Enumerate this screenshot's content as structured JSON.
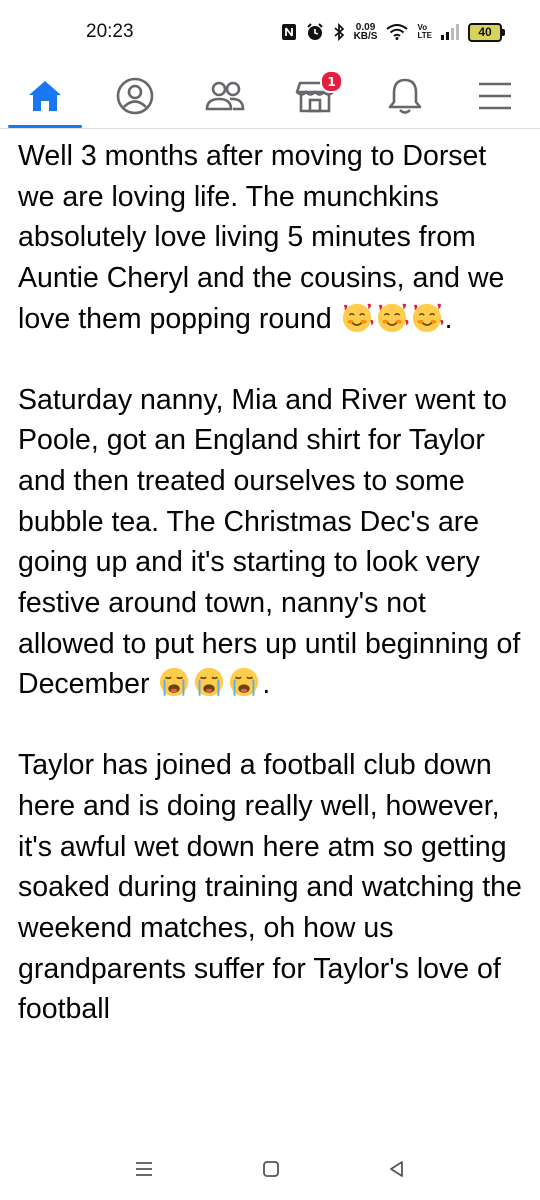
{
  "status_bar": {
    "time": "20:23",
    "net_speed_value": "0.09",
    "net_speed_unit": "KB/S",
    "volte_top": "Vo",
    "volte_bottom": "LTE",
    "battery": "40"
  },
  "nav": {
    "items": [
      {
        "name": "home",
        "icon": "home-icon",
        "active": true
      },
      {
        "name": "profile",
        "icon": "profile-icon"
      },
      {
        "name": "friends",
        "icon": "friends-icon"
      },
      {
        "name": "marketplace",
        "icon": "marketplace-icon",
        "badge": "1"
      },
      {
        "name": "notifications",
        "icon": "bell-icon"
      },
      {
        "name": "menu",
        "icon": "hamburger-icon"
      }
    ],
    "accent": "#1877f2",
    "badge_color": "#e41e3f"
  },
  "post": {
    "paragraph1": "Well 3 months after moving to Dorset we are loving life. The munchkins absolutely love living 5 minutes from Auntie Cheryl and the cousins, and we love them popping round",
    "paragraph1_end": ".",
    "paragraph2": "Saturday nanny,  Mia and River went to Poole,  got an England shirt for Taylor and then treated ourselves to some bubble tea. The Christmas Dec's are going up and it's starting to look very festive around town, nanny's not allowed to put hers up until beginning of December",
    "paragraph2_end": ".",
    "paragraph3": "Taylor has joined a football club down here and is doing really well, however, it's awful wet down here atm so getting soaked during training and watching the weekend matches, oh how us grandparents suffer for Taylor's love of football",
    "emoji_love": "smiling-face-with-hearts",
    "emoji_cry": "loudly-crying-face"
  },
  "system_nav": {
    "recent": "recent-apps-icon",
    "home": "home-square-icon",
    "back": "back-triangle-icon"
  }
}
